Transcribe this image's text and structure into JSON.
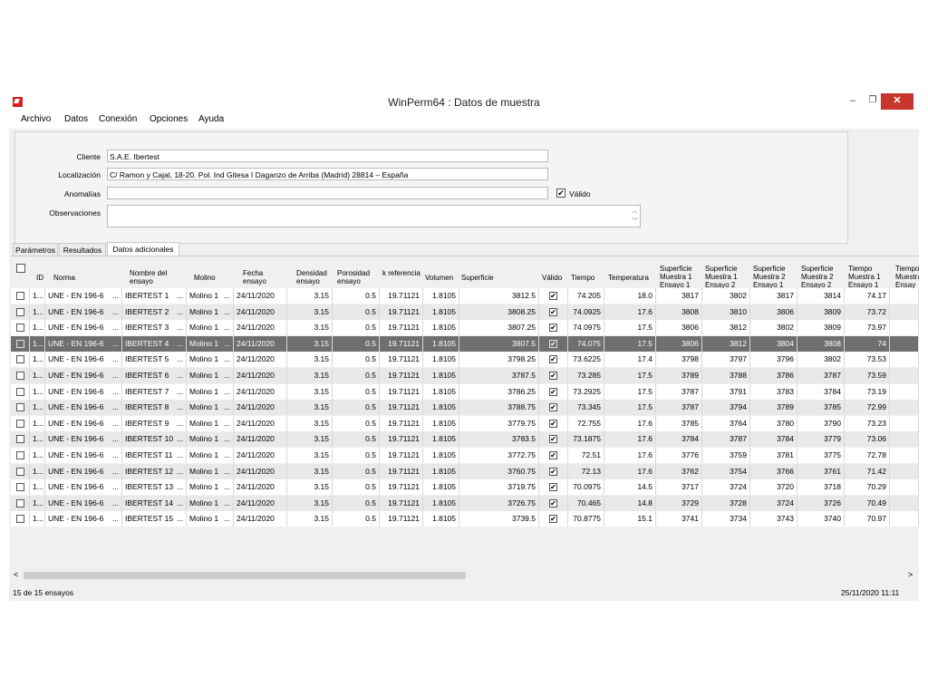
{
  "window": {
    "title": "WinPerm64 : Datos de muestra",
    "minimize": "–",
    "maximize": "❐",
    "close": "✕"
  },
  "menu": [
    "Archivo",
    "Datos",
    "Conexión",
    "Opciones",
    "Ayuda"
  ],
  "client": {
    "cliente_label": "Cliente",
    "cliente_value": "S.A.E. Ibertest",
    "localizacion_label": "Localización",
    "localizacion_value": "C/ Ramon y Cajal, 18-20. Pol. Ind Gitesa I Daganzo de Arriba (Madrid) 28814 – España",
    "anomalias_label": "Anomalías",
    "anomalias_value": "",
    "valido_label": "Válido",
    "valido_checked": true,
    "observaciones_label": "Observaciones",
    "observaciones_value": ""
  },
  "tabs": [
    "Parámetros",
    "Resultados",
    "Datos adicionales"
  ],
  "active_tab": "Datos adicionales",
  "table": {
    "headers": [
      "ID",
      "Norma",
      "Nombre del ensayo",
      "Molino",
      "Fecha ensayo",
      "Densidad ensayo",
      "Porosidad ensayo",
      "k referencia",
      "Volumen",
      "Superficie",
      "Válido",
      "Tiempo",
      "Temperatura",
      "Superficie Muestra 1 Ensayo 1",
      "Superficie Muestra 1 Ensayo 2",
      "Superficie Muestra 2 Ensayo 1",
      "Superficie Muestra 2 Ensayo 2",
      "Tiempo Muestra 1 Ensayo 1",
      "Tiempo Muestra Ensay"
    ],
    "rows": [
      {
        "id": "1...",
        "norma": "UNE - EN 196-6",
        "nombre": "IBERTEST 1",
        "molino": "Molino 1",
        "fecha": "24/11/2020",
        "densidad": "3.15",
        "porosidad": "0.5",
        "k": "19.71121",
        "volumen": "1.8105",
        "superficie": "3812.5",
        "valido": true,
        "tiempo": "74.205",
        "temperatura": "18.0",
        "s11": "3817",
        "s12": "3802",
        "s21": "3817",
        "s22": "3814",
        "t11": "74.17"
      },
      {
        "id": "1...",
        "norma": "UNE - EN 196-6",
        "nombre": "IBERTEST 2",
        "molino": "Molino 1",
        "fecha": "24/11/2020",
        "densidad": "3.15",
        "porosidad": "0.5",
        "k": "19.71121",
        "volumen": "1.8105",
        "superficie": "3808.25",
        "valido": true,
        "tiempo": "74.0925",
        "temperatura": "17.6",
        "s11": "3808",
        "s12": "3810",
        "s21": "3806",
        "s22": "3809",
        "t11": "73.72"
      },
      {
        "id": "1...",
        "norma": "UNE - EN 196-6",
        "nombre": "IBERTEST 3",
        "molino": "Molino 1",
        "fecha": "24/11/2020",
        "densidad": "3.15",
        "porosidad": "0.5",
        "k": "19.71121",
        "volumen": "1.8105",
        "superficie": "3807.25",
        "valido": true,
        "tiempo": "74.0975",
        "temperatura": "17.5",
        "s11": "3806",
        "s12": "3812",
        "s21": "3802",
        "s22": "3809",
        "t11": "73.97"
      },
      {
        "id": "1...",
        "norma": "UNE - EN 196-6",
        "nombre": "IBERTEST 4",
        "molino": "Molino 1",
        "fecha": "24/11/2020",
        "densidad": "3.15",
        "porosidad": "0.5",
        "k": "19.71121",
        "volumen": "1.8105",
        "superficie": "3807.5",
        "valido": true,
        "tiempo": "74.075",
        "temperatura": "17.5",
        "s11": "3806",
        "s12": "3812",
        "s21": "3804",
        "s22": "3808",
        "t11": "74"
      },
      {
        "id": "1...",
        "norma": "UNE - EN 196-6",
        "nombre": "IBERTEST 5",
        "molino": "Molino 1",
        "fecha": "24/11/2020",
        "densidad": "3.15",
        "porosidad": "0.5",
        "k": "19.71121",
        "volumen": "1.8105",
        "superficie": "3798.25",
        "valido": true,
        "tiempo": "73.6225",
        "temperatura": "17.4",
        "s11": "3798",
        "s12": "3797",
        "s21": "3796",
        "s22": "3802",
        "t11": "73.53"
      },
      {
        "id": "1...",
        "norma": "UNE - EN 196-6",
        "nombre": "IBERTEST 6",
        "molino": "Molino 1",
        "fecha": "24/11/2020",
        "densidad": "3.15",
        "porosidad": "0.5",
        "k": "19.71121",
        "volumen": "1.8105",
        "superficie": "3787.5",
        "valido": true,
        "tiempo": "73.285",
        "temperatura": "17.5",
        "s11": "3789",
        "s12": "3788",
        "s21": "3786",
        "s22": "3787",
        "t11": "73.59"
      },
      {
        "id": "1...",
        "norma": "UNE - EN 196-6",
        "nombre": "IBERTEST 7",
        "molino": "Molino 1",
        "fecha": "24/11/2020",
        "densidad": "3.15",
        "porosidad": "0.5",
        "k": "19.71121",
        "volumen": "1.8105",
        "superficie": "3786.25",
        "valido": true,
        "tiempo": "73.2925",
        "temperatura": "17.5",
        "s11": "3787",
        "s12": "3791",
        "s21": "3783",
        "s22": "3784",
        "t11": "73.19"
      },
      {
        "id": "1...",
        "norma": "UNE - EN 196-6",
        "nombre": "IBERTEST 8",
        "molino": "Molino 1",
        "fecha": "24/11/2020",
        "densidad": "3.15",
        "porosidad": "0.5",
        "k": "19.71121",
        "volumen": "1.8105",
        "superficie": "3788.75",
        "valido": true,
        "tiempo": "73.345",
        "temperatura": "17.5",
        "s11": "3787",
        "s12": "3794",
        "s21": "3789",
        "s22": "3785",
        "t11": "72.99"
      },
      {
        "id": "1...",
        "norma": "UNE - EN 196-6",
        "nombre": "IBERTEST 9",
        "molino": "Molino 1",
        "fecha": "24/11/2020",
        "densidad": "3.15",
        "porosidad": "0.5",
        "k": "19.71121",
        "volumen": "1.8105",
        "superficie": "3779.75",
        "valido": true,
        "tiempo": "72.755",
        "temperatura": "17.6",
        "s11": "3785",
        "s12": "3764",
        "s21": "3780",
        "s22": "3790",
        "t11": "73.23"
      },
      {
        "id": "1...",
        "norma": "UNE - EN 196-6",
        "nombre": "IBERTEST 10",
        "molino": "Molino 1",
        "fecha": "24/11/2020",
        "densidad": "3.15",
        "porosidad": "0.5",
        "k": "19.71121",
        "volumen": "1.8105",
        "superficie": "3783.5",
        "valido": true,
        "tiempo": "73.1875",
        "temperatura": "17.6",
        "s11": "3784",
        "s12": "3787",
        "s21": "3784",
        "s22": "3779",
        "t11": "73.06"
      },
      {
        "id": "1...",
        "norma": "UNE - EN 196-6",
        "nombre": "IBERTEST 11",
        "molino": "Molino 1",
        "fecha": "24/11/2020",
        "densidad": "3.15",
        "porosidad": "0.5",
        "k": "19.71121",
        "volumen": "1.8105",
        "superficie": "3772.75",
        "valido": true,
        "tiempo": "72.51",
        "temperatura": "17.6",
        "s11": "3776",
        "s12": "3759",
        "s21": "3781",
        "s22": "3775",
        "t11": "72.78"
      },
      {
        "id": "1...",
        "norma": "UNE - EN 196-6",
        "nombre": "IBERTEST 12",
        "molino": "Molino 1",
        "fecha": "24/11/2020",
        "densidad": "3.15",
        "porosidad": "0.5",
        "k": "19.71121",
        "volumen": "1.8105",
        "superficie": "3760.75",
        "valido": true,
        "tiempo": "72.13",
        "temperatura": "17.6",
        "s11": "3762",
        "s12": "3754",
        "s21": "3766",
        "s22": "3761",
        "t11": "71.42"
      },
      {
        "id": "1...",
        "norma": "UNE - EN 196-6",
        "nombre": "IBERTEST 13",
        "molino": "Molino 1",
        "fecha": "24/11/2020",
        "densidad": "3.15",
        "porosidad": "0.5",
        "k": "19.71121",
        "volumen": "1.8105",
        "superficie": "3719.75",
        "valido": true,
        "tiempo": "70.0975",
        "temperatura": "14.5",
        "s11": "3717",
        "s12": "3724",
        "s21": "3720",
        "s22": "3718",
        "t11": "70.29"
      },
      {
        "id": "1...",
        "norma": "UNE - EN 196-6",
        "nombre": "IBERTEST 14",
        "molino": "Molino 1",
        "fecha": "24/11/2020",
        "densidad": "3.15",
        "porosidad": "0.5",
        "k": "19.71121",
        "volumen": "1.8105",
        "superficie": "3726.75",
        "valido": true,
        "tiempo": "70.465",
        "temperatura": "14.8",
        "s11": "3729",
        "s12": "3728",
        "s21": "3724",
        "s22": "3726",
        "t11": "70.49"
      },
      {
        "id": "1...",
        "norma": "UNE - EN 196-6",
        "nombre": "IBERTEST 15",
        "molino": "Molino 1",
        "fecha": "24/11/2020",
        "densidad": "3.15",
        "porosidad": "0.5",
        "k": "19.71121",
        "volumen": "1.8105",
        "superficie": "3739.5",
        "valido": true,
        "tiempo": "70.8775",
        "temperatura": "15.1",
        "s11": "3741",
        "s12": "3734",
        "s21": "3743",
        "s22": "3740",
        "t11": "70.97"
      }
    ],
    "selected_row": 4
  },
  "scroll": {
    "left_arrow": "<",
    "right_arrow": ">"
  },
  "status": {
    "count": "15 de 15 ensayos",
    "datetime": "25/11/2020 11:11"
  },
  "icons": {
    "checkbox_mark": "✔",
    "scroll_up": "︿",
    "scroll_down": "﹀"
  },
  "colors": {
    "close_button": "#c7352c",
    "selected_row": "#6f6f6f",
    "app_icon": "#d42020"
  }
}
